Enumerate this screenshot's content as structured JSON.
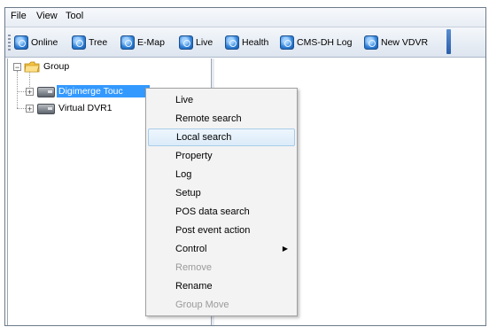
{
  "menubar": {
    "items": [
      "File",
      "View",
      "Tool"
    ]
  },
  "toolbar": {
    "buttons": [
      {
        "label": "Online",
        "icon": "online-icon"
      },
      {
        "label": "Tree",
        "icon": "tree-icon"
      },
      {
        "label": "E-Map",
        "icon": "emap-icon"
      },
      {
        "label": "Live",
        "icon": "live-icon"
      },
      {
        "label": "Health",
        "icon": "health-icon"
      },
      {
        "label": "CMS-DH Log",
        "icon": "log-icon"
      },
      {
        "label": "New VDVR",
        "icon": "new-vdvr-icon"
      }
    ]
  },
  "tree": {
    "root": {
      "label": "Group",
      "expander": "−"
    },
    "children": [
      {
        "label": "Digimerge Touc",
        "expander": "+",
        "selected": true
      },
      {
        "label": "Virtual DVR1",
        "expander": "+",
        "selected": false
      }
    ]
  },
  "context_menu": {
    "items": [
      {
        "label": "Live",
        "state": "normal"
      },
      {
        "label": "Remote search",
        "state": "normal"
      },
      {
        "label": "Local search",
        "state": "hover"
      },
      {
        "label": "Property",
        "state": "normal"
      },
      {
        "label": "Log",
        "state": "normal"
      },
      {
        "label": "Setup",
        "state": "normal"
      },
      {
        "label": "POS data search",
        "state": "normal"
      },
      {
        "label": "Post event action",
        "state": "normal"
      },
      {
        "label": "Control",
        "state": "submenu"
      },
      {
        "label": "Remove",
        "state": "disabled"
      },
      {
        "label": "Rename",
        "state": "normal"
      },
      {
        "label": "Group Move",
        "state": "disabled"
      }
    ],
    "submenu_glyph": "▶"
  },
  "colors": {
    "selection": "#3399ff",
    "disabled_text": "#9a9a9a",
    "hover_border": "#a8cce9"
  }
}
